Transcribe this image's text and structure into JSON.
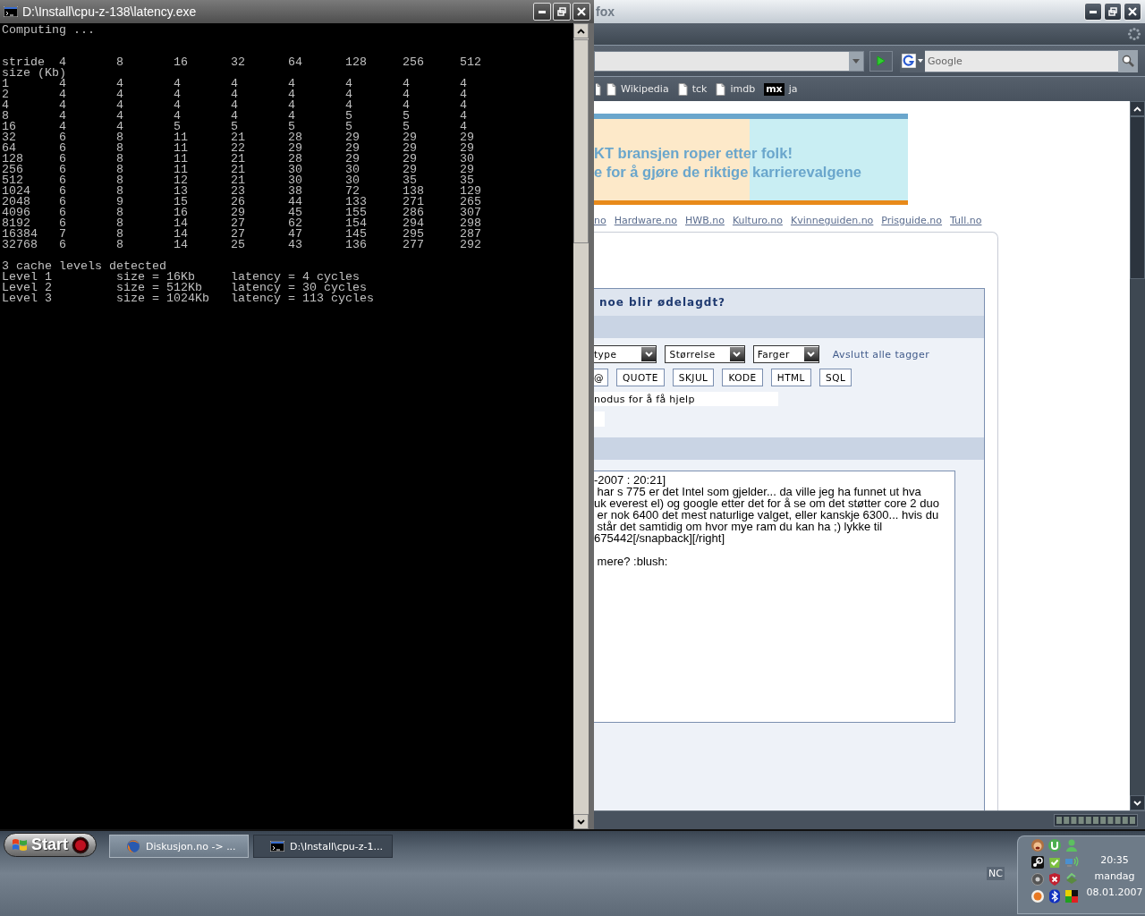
{
  "console_window": {
    "title": "D:\\Install\\cpu-z-138\\latency.exe",
    "status": "Computing ...",
    "table": {
      "header_label": "stride",
      "columns": [
        "4",
        "8",
        "16",
        "32",
        "64",
        "128",
        "256",
        "512"
      ],
      "subheader": "size (Kb)",
      "rows": [
        {
          "size": "1",
          "values": [
            "4",
            "4",
            "4",
            "4",
            "4",
            "4",
            "4",
            "4"
          ]
        },
        {
          "size": "2",
          "values": [
            "4",
            "4",
            "4",
            "4",
            "4",
            "4",
            "4",
            "4"
          ]
        },
        {
          "size": "4",
          "values": [
            "4",
            "4",
            "4",
            "4",
            "4",
            "4",
            "4",
            "4"
          ]
        },
        {
          "size": "8",
          "values": [
            "4",
            "4",
            "4",
            "4",
            "4",
            "5",
            "5",
            "4"
          ]
        },
        {
          "size": "16",
          "values": [
            "4",
            "4",
            "5",
            "5",
            "5",
            "5",
            "5",
            "4"
          ]
        },
        {
          "size": "32",
          "values": [
            "6",
            "8",
            "11",
            "21",
            "28",
            "29",
            "29",
            "29"
          ]
        },
        {
          "size": "64",
          "values": [
            "6",
            "8",
            "11",
            "22",
            "29",
            "29",
            "29",
            "29"
          ]
        },
        {
          "size": "128",
          "values": [
            "6",
            "8",
            "11",
            "21",
            "28",
            "29",
            "29",
            "30"
          ]
        },
        {
          "size": "256",
          "values": [
            "6",
            "8",
            "11",
            "21",
            "30",
            "30",
            "29",
            "29"
          ]
        },
        {
          "size": "512",
          "values": [
            "6",
            "8",
            "12",
            "21",
            "30",
            "30",
            "35",
            "35"
          ]
        },
        {
          "size": "1024",
          "values": [
            "6",
            "8",
            "13",
            "23",
            "38",
            "72",
            "138",
            "129"
          ]
        },
        {
          "size": "2048",
          "values": [
            "6",
            "9",
            "15",
            "26",
            "44",
            "133",
            "271",
            "265"
          ]
        },
        {
          "size": "4096",
          "values": [
            "6",
            "8",
            "16",
            "29",
            "45",
            "155",
            "286",
            "307"
          ]
        },
        {
          "size": "8192",
          "values": [
            "6",
            "8",
            "14",
            "27",
            "62",
            "154",
            "294",
            "298"
          ]
        },
        {
          "size": "16384",
          "values": [
            "7",
            "8",
            "14",
            "27",
            "47",
            "145",
            "295",
            "287"
          ]
        },
        {
          "size": "32768",
          "values": [
            "6",
            "8",
            "14",
            "25",
            "43",
            "136",
            "277",
            "292"
          ]
        }
      ]
    },
    "summary": "3 cache levels detected",
    "levels": [
      {
        "name": "Level 1",
        "size": "size = 16Kb",
        "latency": "latency = 4 cycles"
      },
      {
        "name": "Level 2",
        "size": "size = 512Kb",
        "latency": "latency = 30 cycles"
      },
      {
        "name": "Level 3",
        "size": "size = 1024Kb",
        "latency": "latency = 113 cycles"
      }
    ]
  },
  "browser_window": {
    "title": "fox",
    "search": {
      "placeholder": "Google"
    },
    "bookmarks": [
      {
        "label": "Wikipedia",
        "kind": "page"
      },
      {
        "label": "tck",
        "kind": "page"
      },
      {
        "label": "imdb",
        "kind": "page"
      },
      {
        "label": "ja",
        "kind": "badge",
        "badge": "mx"
      }
    ],
    "banner": {
      "lines": [
        "KT bransjen roper etter folk!",
        "e for å gjøre de riktige karrierevalgene"
      ]
    },
    "site_links": [
      "no",
      "Hardware.no",
      "HWB.no",
      "Kulturo.no",
      "Kvinneguiden.no",
      "Prisguide.no",
      "Tull.no"
    ],
    "forum": {
      "title": "noe blir ødelagdt?",
      "selects": [
        "type",
        "Størrelse",
        "Farger"
      ],
      "close_tags_link": "Avslutt alle tagger",
      "tag_buttons": [
        "@",
        "QUOTE",
        "SKJUL",
        "KODE",
        "HTML",
        "SQL"
      ],
      "hint": "nodus for å få hjelp",
      "message": "-2007 : 20:21]\n har s 775 er det Intel som gjelder... da ville jeg ha funnet ut hva\nuk everest el) og google etter det for å se om det støtter core 2 duo\n er nok 6400 det mest naturlige valget, eller kanskje 6300... hvis du\n står det samtidig om hvor mye ram du kan ha ;) lykke til\n675442[/snapback][/right]\n\n mere? :blush:"
    }
  },
  "taskbar": {
    "start": "Start",
    "tasks": [
      {
        "label": "Diskusjon.no -> ...",
        "kind": "browser",
        "selected": true
      },
      {
        "label": "D:\\Install\\cpu-z-1...",
        "kind": "console",
        "selected": false
      }
    ],
    "tray_label": "NC",
    "clock": {
      "time": "20:35",
      "day": "mandag",
      "date": "08.01.2007"
    }
  }
}
